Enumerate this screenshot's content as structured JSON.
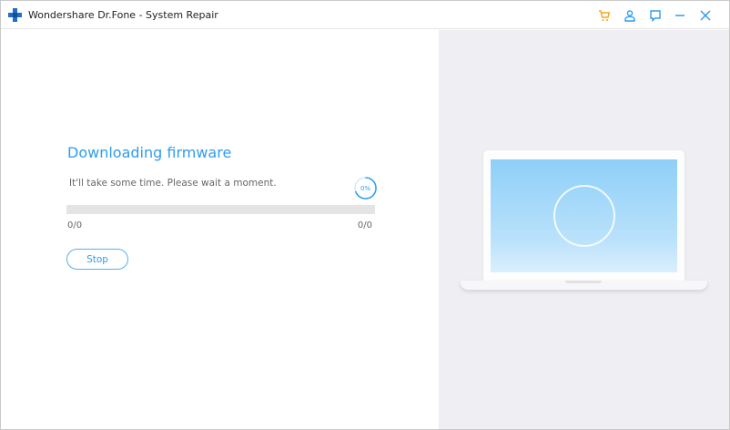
{
  "window": {
    "title": "Wondershare Dr.Fone - System Repair",
    "logo_icon": "plus-cross-logo-icon",
    "controls": [
      {
        "name": "cart-icon",
        "color": "#f5a623"
      },
      {
        "name": "account-icon",
        "color": "#2e9df0"
      },
      {
        "name": "feedback-icon",
        "color": "#2e9df0"
      },
      {
        "name": "minimize-icon",
        "color": "#2e9df0"
      },
      {
        "name": "close-icon",
        "color": "#2e9df0"
      }
    ]
  },
  "download": {
    "heading": "Downloading firmware",
    "subtext": "It'll take some time. Please wait a moment.",
    "percent_label": "0%",
    "progress_fraction": 0,
    "count_left": "0/0",
    "count_right": "0/0",
    "stop_label": "Stop"
  },
  "colors": {
    "accent": "#2e9df0",
    "cart": "#f5a623",
    "track": "#e4e4e6",
    "illustration_bg": "#efeef2"
  }
}
